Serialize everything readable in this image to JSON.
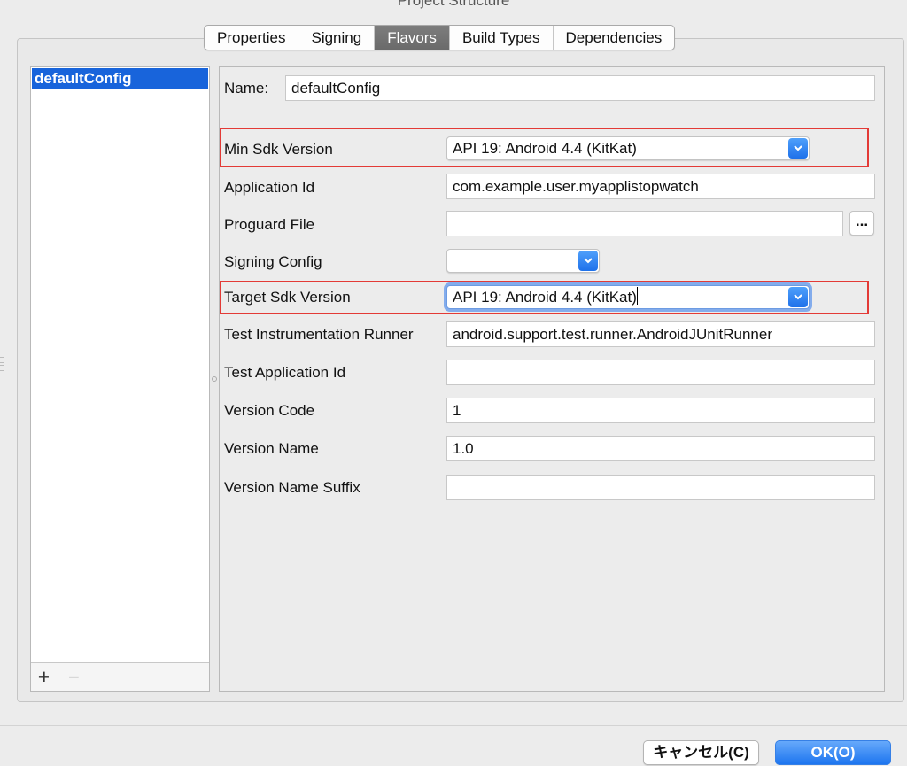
{
  "window": {
    "title": "Project Structure"
  },
  "tabs": [
    "Properties",
    "Signing",
    "Flavors",
    "Build Types",
    "Dependencies"
  ],
  "active_tab": "Flavors",
  "flavor_list": {
    "items": [
      "defaultConfig"
    ],
    "selected": "defaultConfig",
    "add_label": "+",
    "remove_label": "−"
  },
  "form": {
    "name": {
      "label": "Name:",
      "value": "defaultConfig"
    },
    "min_sdk": {
      "label": "Min Sdk Version",
      "value": "API 19: Android 4.4 (KitKat)"
    },
    "application_id": {
      "label": "Application Id",
      "value": "com.example.user.myapplistopwatch"
    },
    "proguard_file": {
      "label": "Proguard File",
      "value": "",
      "browse_label": "..."
    },
    "signing_config": {
      "label": "Signing Config",
      "value": ""
    },
    "target_sdk": {
      "label": "Target Sdk Version",
      "value": "API 19: Android 4.4 (KitKat)"
    },
    "test_runner": {
      "label": "Test Instrumentation Runner",
      "value": "android.support.test.runner.AndroidJUnitRunner"
    },
    "test_app_id": {
      "label": "Test Application Id",
      "value": ""
    },
    "version_code": {
      "label": "Version Code",
      "value": "1"
    },
    "version_name": {
      "label": "Version Name",
      "value": "1.0"
    },
    "version_name_suffix": {
      "label": "Version Name Suffix",
      "value": ""
    }
  },
  "buttons": {
    "cancel": "キャンセル(C)",
    "ok": "OK(O)"
  },
  "colors": {
    "accent": "#1e71ea",
    "selection": "#1864db",
    "highlight_box": "#e33a36",
    "active_tab": "#6f6f6f"
  }
}
